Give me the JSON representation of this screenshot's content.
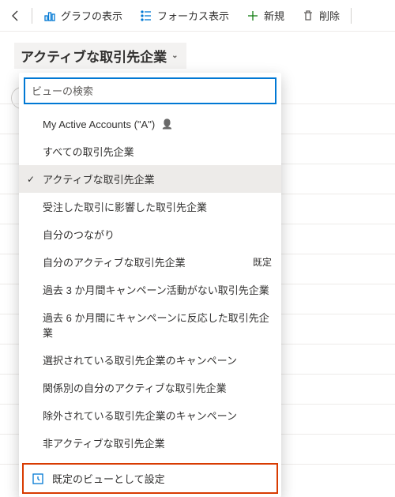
{
  "toolbar": {
    "show_chart": "グラフの表示",
    "focus_view": "フォーカス表示",
    "new": "新規",
    "delete": "削除"
  },
  "view_header": {
    "title": "アクティブな取引先企業"
  },
  "search": {
    "placeholder": "ビューの検索"
  },
  "views": [
    {
      "label": "My Active Accounts (\"A\")",
      "person": true
    },
    {
      "label": "すべての取引先企業"
    },
    {
      "label": "アクティブな取引先企業",
      "selected": true
    },
    {
      "label": "受注した取引に影響した取引先企業"
    },
    {
      "label": "自分のつながり"
    },
    {
      "label": "自分のアクティブな取引先企業",
      "default": true
    },
    {
      "label": "過去 3 か月間キャンペーン活動がない取引先企業"
    },
    {
      "label": "過去 6 か月間にキャンペーンに反応した取引先企業"
    },
    {
      "label": "選択されている取引先企業のキャンペーン"
    },
    {
      "label": "関係別の自分のアクティブな取引先企業"
    },
    {
      "label": "除外されている取引先企業のキャンペーン"
    },
    {
      "label": "非アクティブな取引先企業"
    }
  ],
  "default_badge": "既定",
  "footer": {
    "set_default": "既定のビューとして設定"
  }
}
